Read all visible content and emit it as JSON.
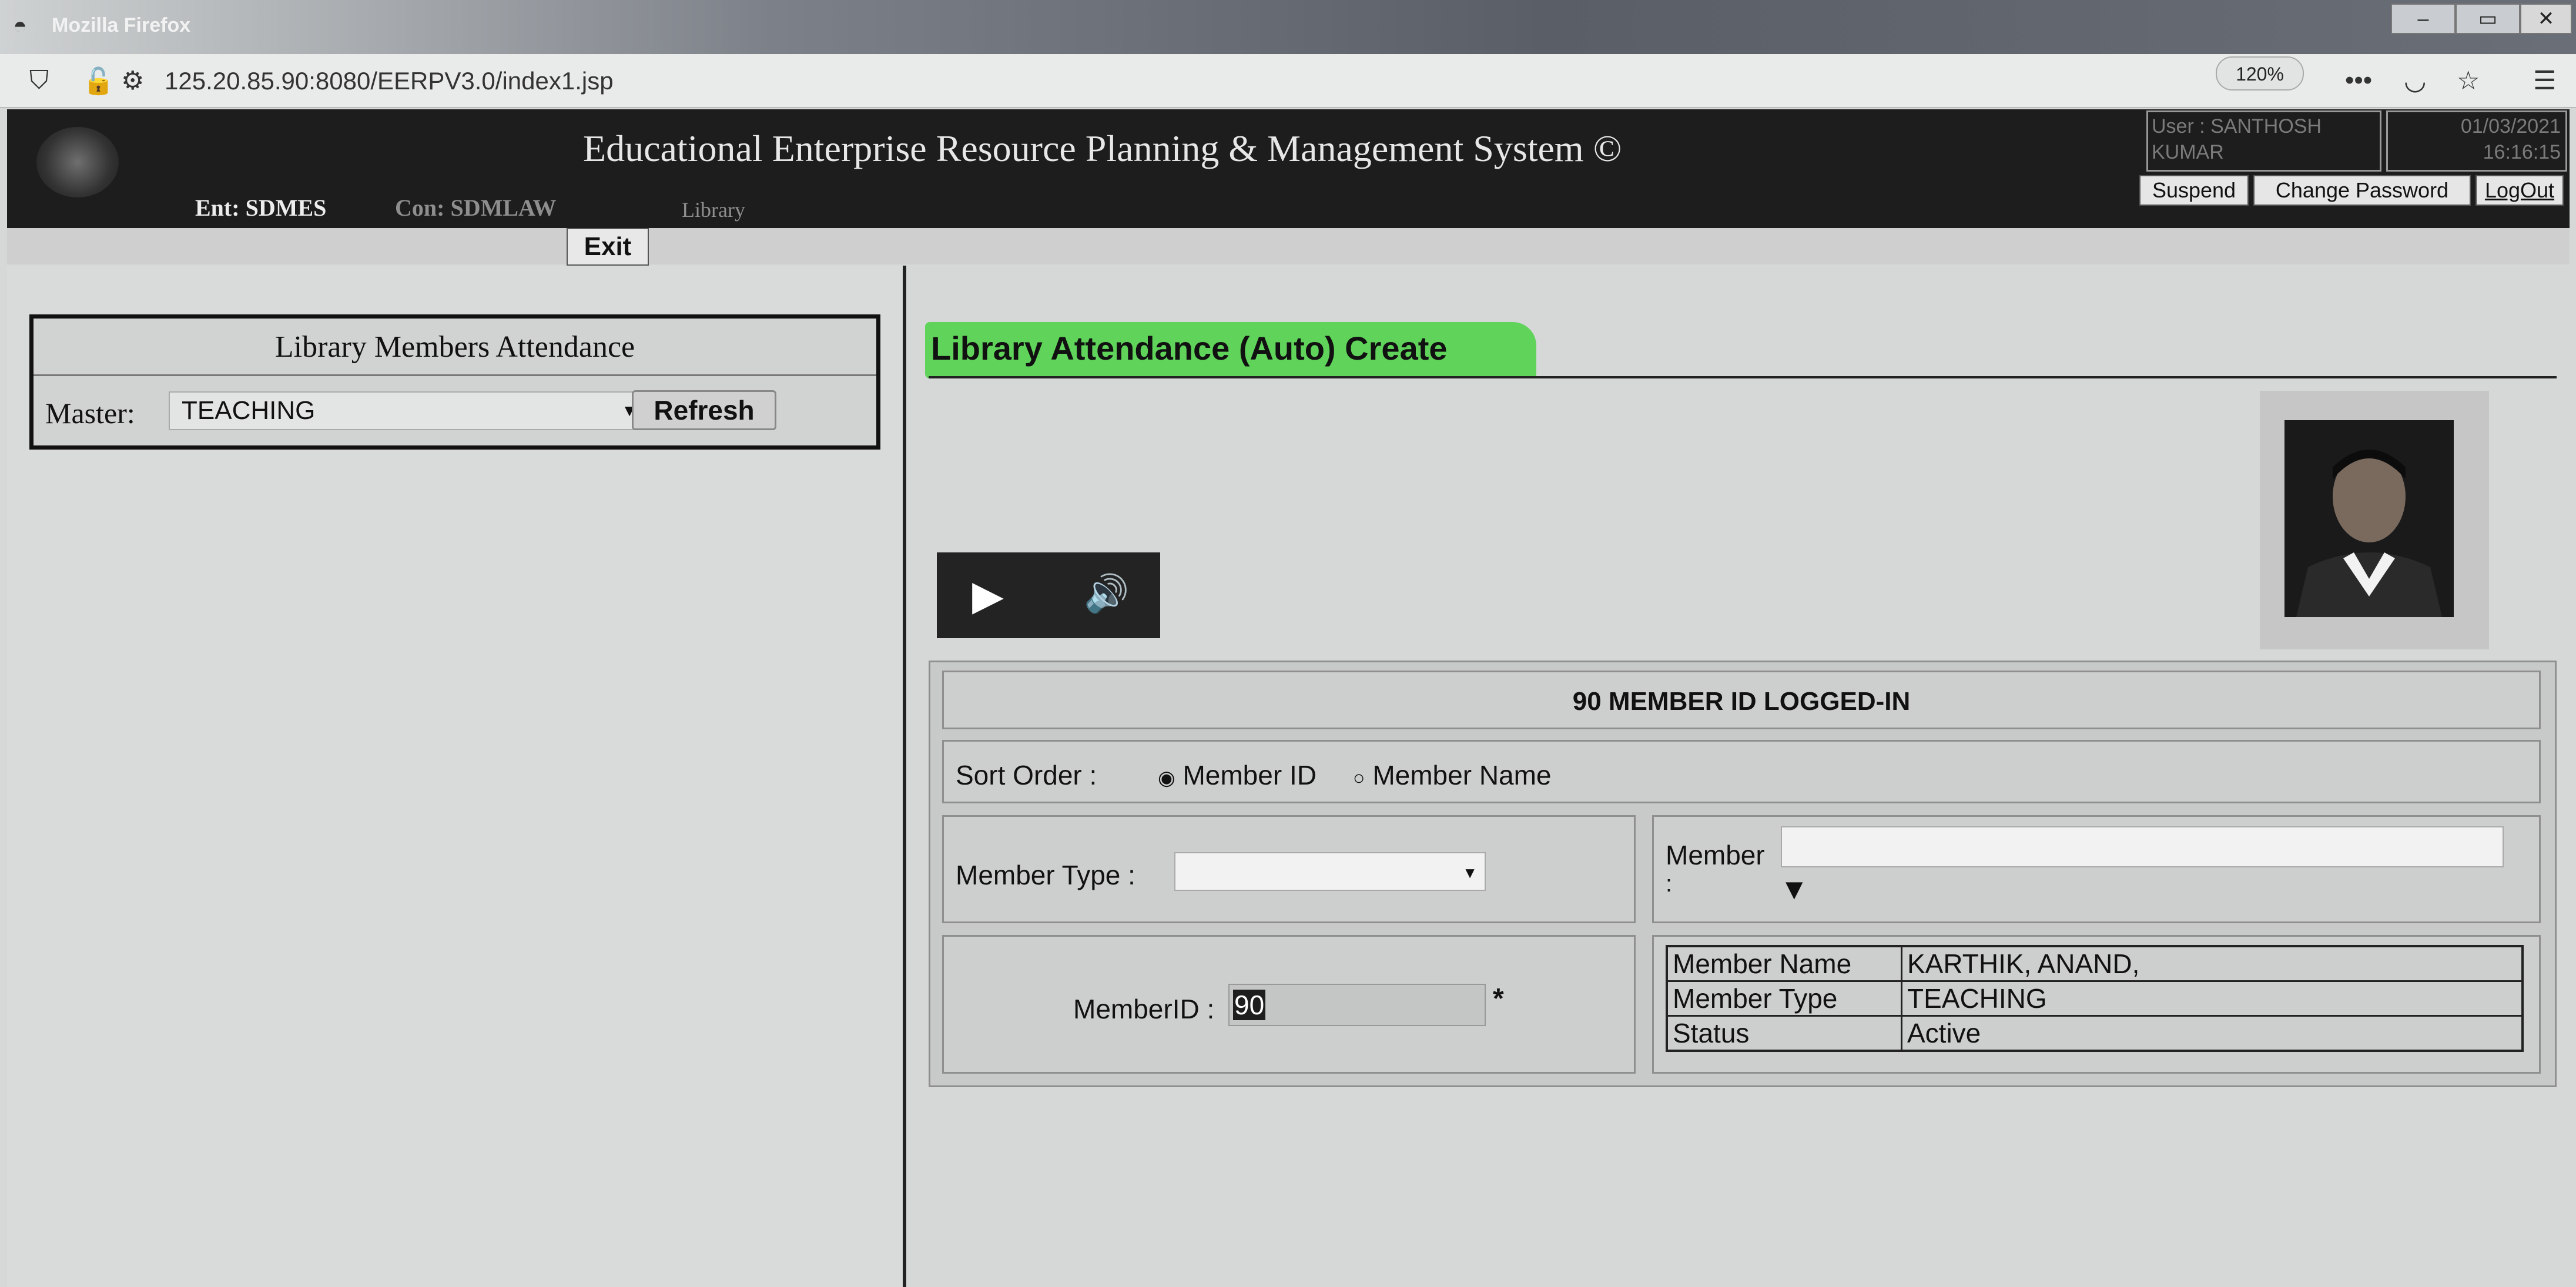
{
  "browser": {
    "window_title": "Mozilla Firefox",
    "url": "125.20.85.90:8080/EERPV3.0/index1.jsp",
    "zoom": "120%",
    "window_buttons": [
      "–",
      "▭",
      "✕"
    ]
  },
  "header": {
    "app_title": "Educational Enterprise Resource Planning & Management System ©",
    "ent": "Ent: SDMES",
    "con": "Con: SDMLAW",
    "module": "Library",
    "user_line1": "User : SANTHOSH",
    "user_line2": "KUMAR",
    "date_line1": "01/03/2021",
    "date_line2": "16:16:15",
    "buttons": {
      "suspend": "Suspend",
      "change_password": "Change Password",
      "logout": "LogOut"
    },
    "exit": "Exit"
  },
  "left_panel": {
    "title": "Library Members Attendance",
    "master_label": "Master:",
    "master_value": "TEACHING",
    "refresh": "Refresh"
  },
  "main": {
    "title": "Library Attendance (Auto) Create",
    "logged_in_message": "90 MEMBER ID LOGGED-IN",
    "sort_order_label": "Sort Order :",
    "sort_options": [
      "Member ID",
      "Member Name"
    ],
    "sort_selected": "Member ID",
    "member_type_label": "Member Type :",
    "member_type_value": "",
    "member_label": "Member",
    "member_colon": ":",
    "member_id_label": "MemberID :",
    "member_id_value": "90",
    "required_mark": "*",
    "info_table": [
      {
        "label": "Member Name",
        "value": "KARTHIK, ANAND,"
      },
      {
        "label": "Member Type",
        "value": "TEACHING"
      },
      {
        "label": "Status",
        "value": "Active"
      }
    ]
  },
  "colors": {
    "header_bg": "#1d1d1d",
    "title_highlight": "#5fd35a",
    "panel_bg": "#d9dbda"
  }
}
